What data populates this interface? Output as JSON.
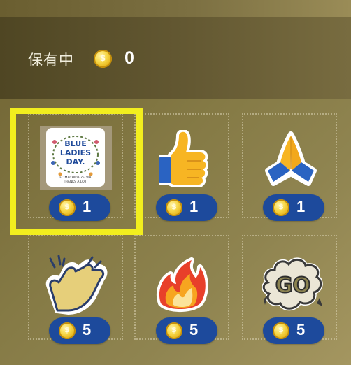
{
  "header": {
    "balance_label": "保有中",
    "coin_symbol": "$",
    "balance_value": "0"
  },
  "stickers": [
    {
      "name": "blue-ladies-day",
      "price": "1",
      "selected": true,
      "image_text": [
        "BLUE",
        "LADIES",
        "DAY.",
        "FC MACHIDA ZELVIA",
        "THANKS A LOT!"
      ]
    },
    {
      "name": "thumbs-up",
      "price": "1"
    },
    {
      "name": "folded-hands",
      "price": "1"
    },
    {
      "name": "clapping-hands",
      "price": "5"
    },
    {
      "name": "fire",
      "price": "5"
    },
    {
      "name": "go-burst",
      "price": "5",
      "image_text": [
        "GO"
      ]
    }
  ],
  "colors": {
    "selection": "#f2ee1e",
    "price_pill": "#1d4a9c",
    "coin": "#f2c420"
  }
}
